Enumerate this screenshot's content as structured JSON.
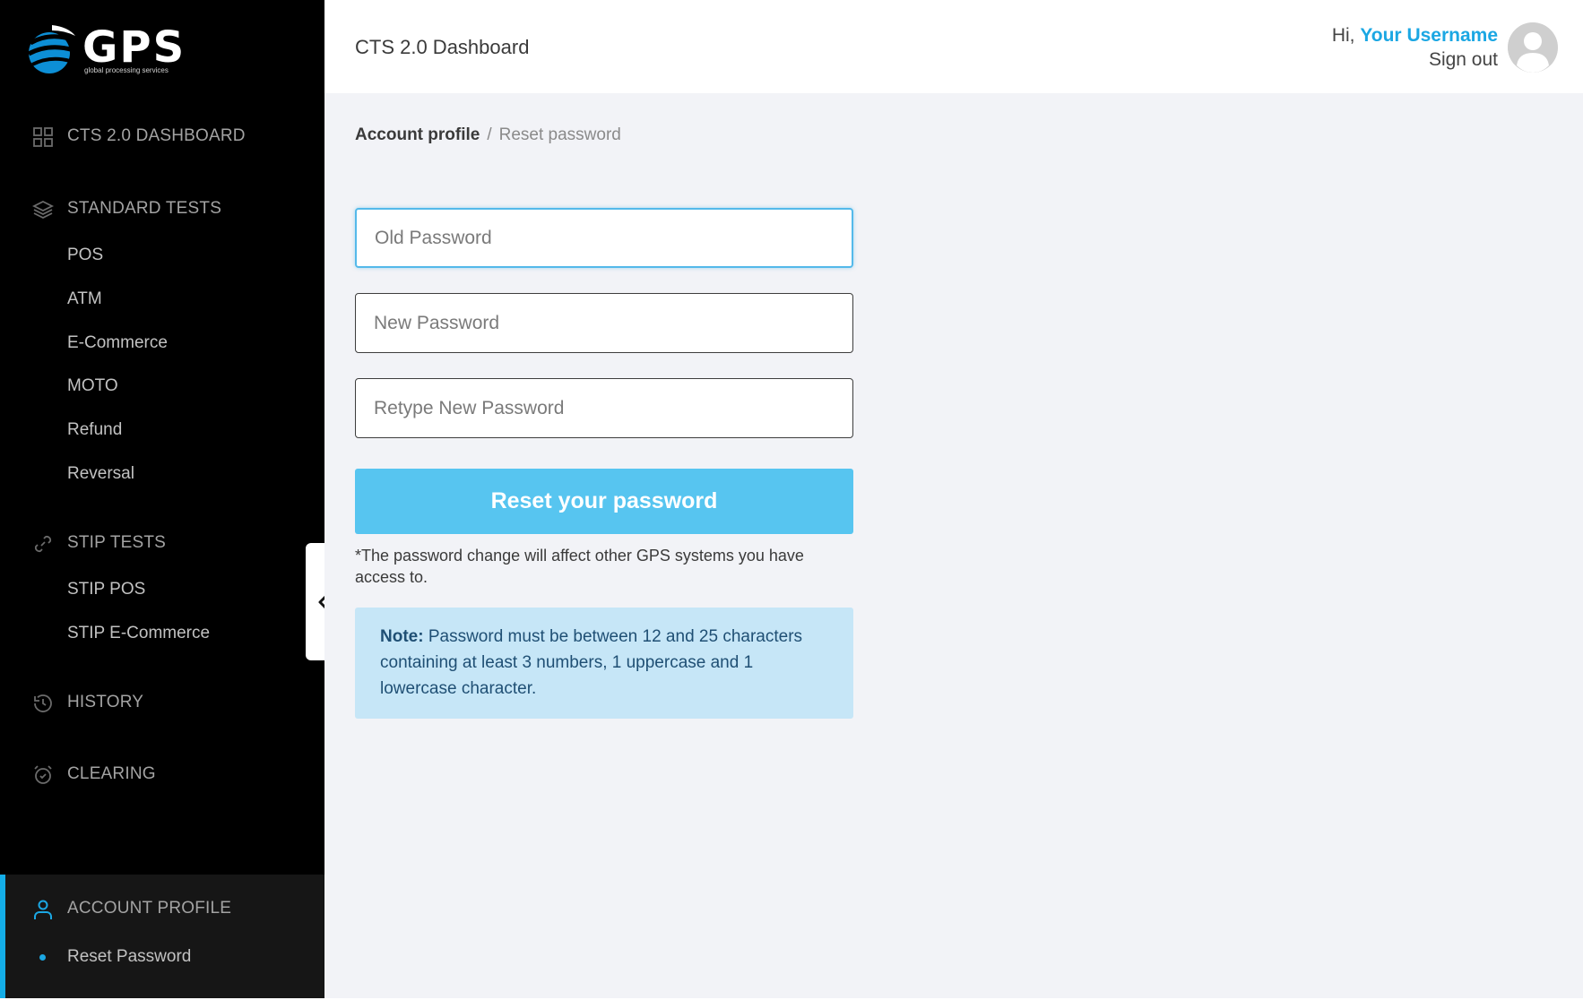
{
  "brand": {
    "name": "GPS",
    "tagline": "global processing services",
    "accent": "#1ba7e3"
  },
  "sidebar": {
    "dashboard": {
      "label": "CTS 2.0 DASHBOARD",
      "icon": "grid-icon"
    },
    "standard_tests": {
      "label": "STANDARD TESTS",
      "icon": "layers-icon",
      "items": [
        "POS",
        "ATM",
        "E-Commerce",
        "MOTO",
        "Refund",
        "Reversal"
      ]
    },
    "stip_tests": {
      "label": "STIP TESTS",
      "icon": "link-icon",
      "items": [
        "STIP POS",
        "STIP E-Commerce"
      ]
    },
    "history": {
      "label": "HISTORY",
      "icon": "history-icon"
    },
    "clearing": {
      "label": "CLEARING",
      "icon": "alarm-clock-icon"
    },
    "account_profile": {
      "label": "ACCOUNT PROFILE",
      "icon": "user-icon",
      "items": [
        "Reset Password"
      ],
      "active_item": "Reset Password"
    }
  },
  "header": {
    "title": "CTS 2.0 Dashboard",
    "greeting": "Hi,",
    "username": "Your Username",
    "sign_out": "Sign out"
  },
  "breadcrumb": {
    "parent": "Account profile",
    "separator": "/",
    "current": "Reset password"
  },
  "form": {
    "old_password_placeholder": "Old Password",
    "new_password_placeholder": "New Password",
    "retype_password_placeholder": "Retype New Password",
    "submit_label": "Reset your password",
    "hint": "*The password change will affect other GPS systems you have access to.",
    "note_label": "Note:",
    "note_text": "Password must be between 12 and 25 characters containing at least 3 numbers, 1 uppercase and 1 lowercase character."
  }
}
